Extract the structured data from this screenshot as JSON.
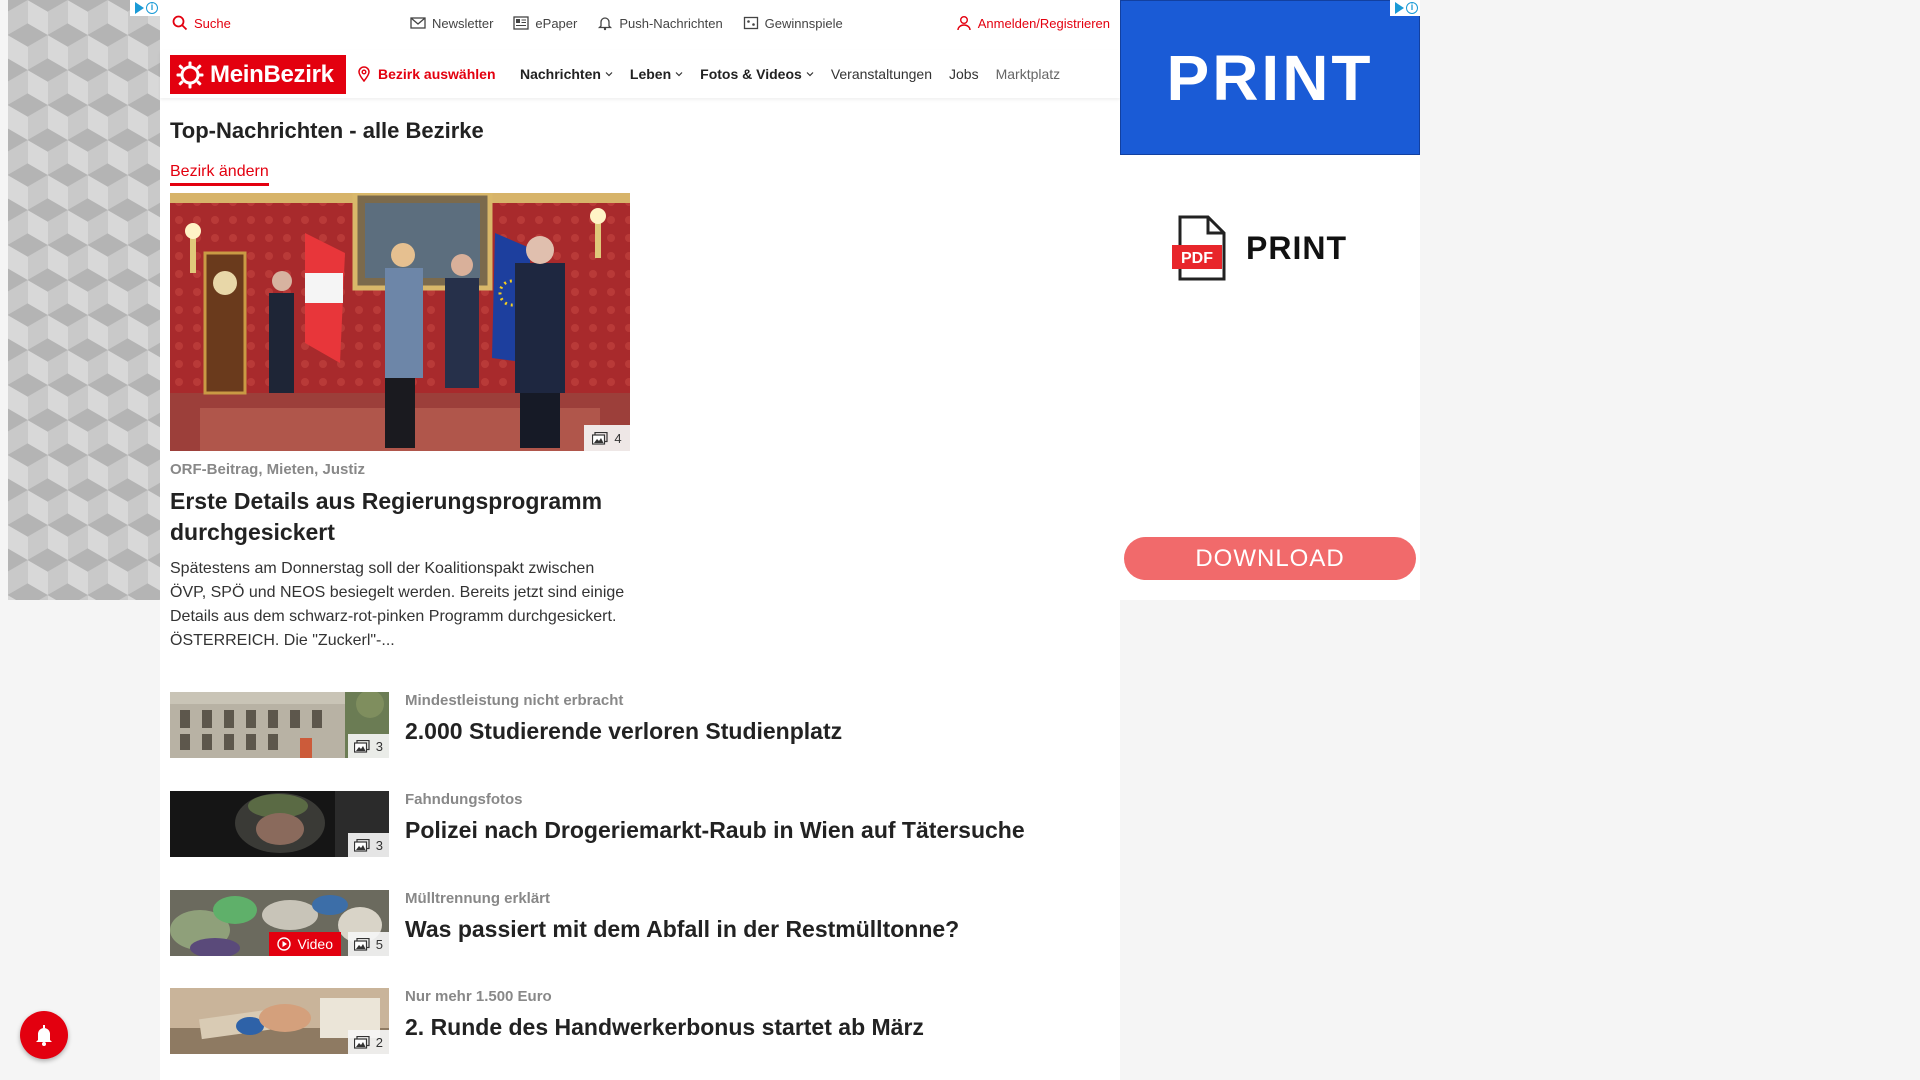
{
  "topbar": {
    "search_label": "Suche",
    "links": [
      {
        "label": "Newsletter",
        "icon": "mail-icon"
      },
      {
        "label": "ePaper",
        "icon": "newspaper-icon"
      },
      {
        "label": "Push-Nachrichten",
        "icon": "bell-icon"
      },
      {
        "label": "Gewinnspiele",
        "icon": "gift-icon"
      }
    ],
    "login_label": "Anmelden/Registrieren"
  },
  "nav": {
    "logo_text": "MeinBezirk",
    "bezirk_label": "Bezirk auswählen",
    "items": [
      {
        "label": "Nachrichten",
        "dropdown": true
      },
      {
        "label": "Leben",
        "dropdown": true
      },
      {
        "label": "Fotos & Videos",
        "dropdown": true
      },
      {
        "label": "Veranstaltungen",
        "dropdown": false
      },
      {
        "label": "Jobs",
        "dropdown": false
      },
      {
        "label": "Marktplatz",
        "dropdown": false
      }
    ]
  },
  "page": {
    "title": "Top-Nachrichten - alle Bezirke",
    "change_district": "Bezirk ändern"
  },
  "hero": {
    "image_count": "4",
    "kicker": "ORF-Beitrag, Mieten, Justiz",
    "title": "Erste Details aus Regierungsprogramm durchgesickert",
    "teaser": "Spätestens am Donnerstag soll der Koalitionspakt zwischen ÖVP, SPÖ und NEOS besiegelt werden. Bereits jetzt sind einige Details aus dem schwarz-rot-pinken Programm durchgesickert.  ÖSTERREICH. Die \"Zuckerl\"-..."
  },
  "articles": [
    {
      "kicker": "Mindestleistung nicht erbracht",
      "title": "2.000 Studierende verloren Studienplatz",
      "image_count": "3"
    },
    {
      "kicker": "Fahndungsfotos",
      "title": "Polizei nach Drogeriemarkt-Raub in Wien auf Tätersuche",
      "image_count": "3"
    },
    {
      "kicker": "Mülltrennung erklärt",
      "title": "Was passiert mit dem Abfall in der Restmülltonne?",
      "image_count": "5",
      "video_label": "Video"
    },
    {
      "kicker": "Nur mehr 1.500 Euro",
      "title": "2. Runde des Handwerkerbonus startet ab März",
      "image_count": "2"
    }
  ],
  "ad_right": {
    "banner_text": "PRINT",
    "pdf_badge": "PDF",
    "pdf_label": "PRINT",
    "download_label": "DOWNLOAD"
  },
  "colors": {
    "brand_red": "#e3000f",
    "ad_blue": "#1a5bd6",
    "download_pink": "#f16a6b"
  }
}
